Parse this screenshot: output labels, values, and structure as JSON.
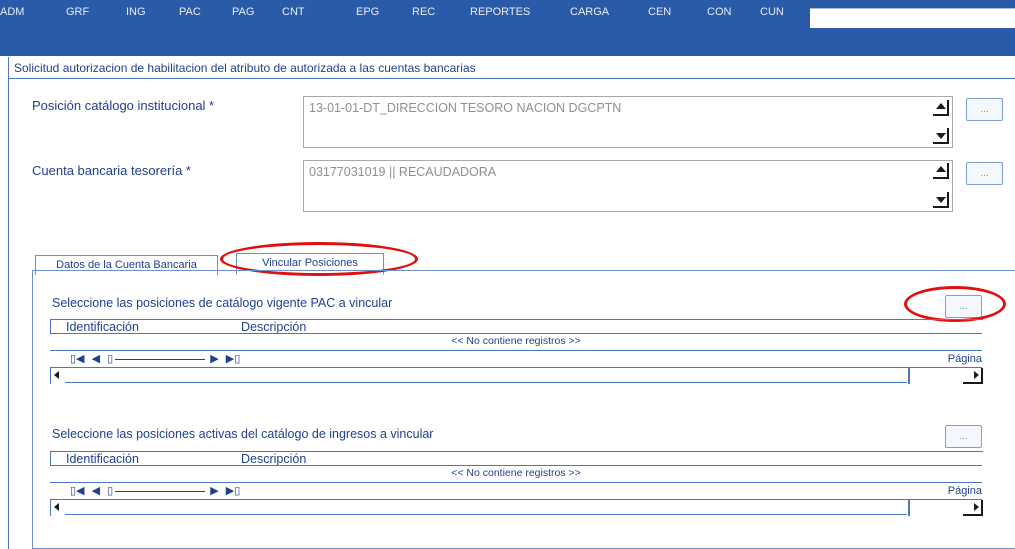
{
  "menu": [
    "ADM",
    "GRF",
    "ING",
    "PAC",
    "PAG",
    "CNT",
    "EPG",
    "REC",
    "REPORTES",
    "CARGA",
    "CEN",
    "CON",
    "CUN"
  ],
  "form_title": "Solicitud autorizacion de habilitacion del atributo de autorizada a las cuentas bancarias",
  "field1": {
    "label": "Posición catálogo institucional *",
    "value": "13-01-01-DT_DIRECCION TESORO NACION DGCPTN",
    "button": "..."
  },
  "field2": {
    "label": "Cuenta bancaria tesorería *",
    "value": "03177031019 || RECAUDADORA",
    "button": "..."
  },
  "tabs": [
    "Datos de la Cuenta Bancaria",
    "Vincular Posiciones"
  ],
  "section1": {
    "label": "Seleccione las posiciones de catálogo vigente PAC a vincular",
    "button": "...",
    "columns": [
      "Identificación",
      "Descripción"
    ],
    "empty": "<< No contiene registros >>",
    "page_label": "Página"
  },
  "section2": {
    "label": "Seleccione las posiciones activas del catálogo de ingresos a vincular",
    "button": "...",
    "columns": [
      "Identificación",
      "Descripción"
    ],
    "empty": "<< No contiene registros >>",
    "page_label": "Página"
  },
  "pager_icons": {
    "first": "first-page-icon",
    "prev": "prev-page-icon",
    "next": "next-page-icon",
    "last": "last-page-icon"
  },
  "colors": {
    "menu_bg": "#2a5ba8",
    "text": "#1f3f8f",
    "highlight": "#e01010"
  }
}
